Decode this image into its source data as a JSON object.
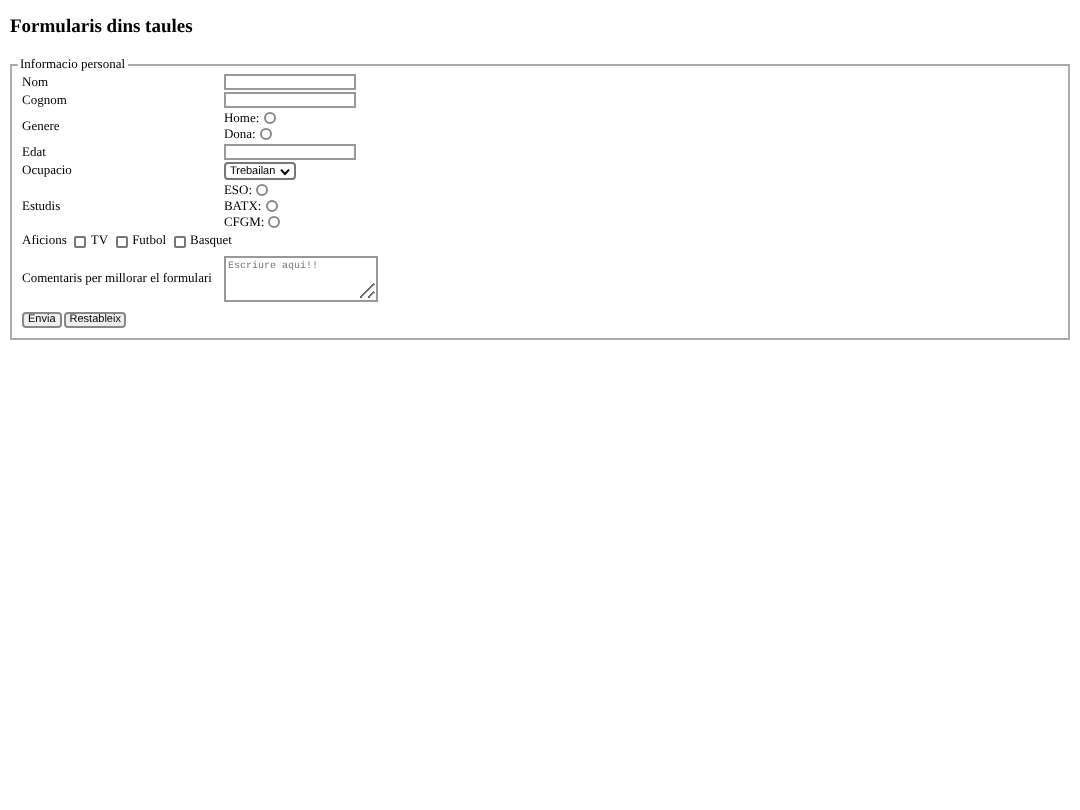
{
  "title": "Formularis dins taules",
  "fieldset": {
    "legend": "Informacio personal",
    "rows": [
      {
        "kind": "text",
        "label": "Nom"
      },
      {
        "kind": "text",
        "label": "Cognom"
      },
      {
        "kind": "radio",
        "label": "Genere",
        "options": [
          {
            "label": "Home:",
            "selected": false
          },
          {
            "label": "Dona:",
            "selected": false
          }
        ]
      },
      {
        "kind": "text",
        "label": "Edat"
      },
      {
        "kind": "select",
        "label": "Ocupacio",
        "value": "Trebailan"
      },
      {
        "kind": "radio",
        "label": "Estudis",
        "options": [
          {
            "label": "ESO:",
            "selected": false
          },
          {
            "label": "BATX:",
            "selected": false
          },
          {
            "label": "CFGM:",
            "selected": false
          }
        ]
      }
    ],
    "hobbies": {
      "label": "Aficions",
      "options": [
        {
          "label": "TV",
          "checked": false
        },
        {
          "label": "Futbol",
          "checked": false
        },
        {
          "label": "Basquet",
          "checked": false
        }
      ]
    },
    "comments": {
      "label": "Comentaris per millorar el formulari",
      "placeholder": "Escriure aqui!!"
    },
    "buttons": [
      "Envia",
      "Restableix"
    ]
  }
}
